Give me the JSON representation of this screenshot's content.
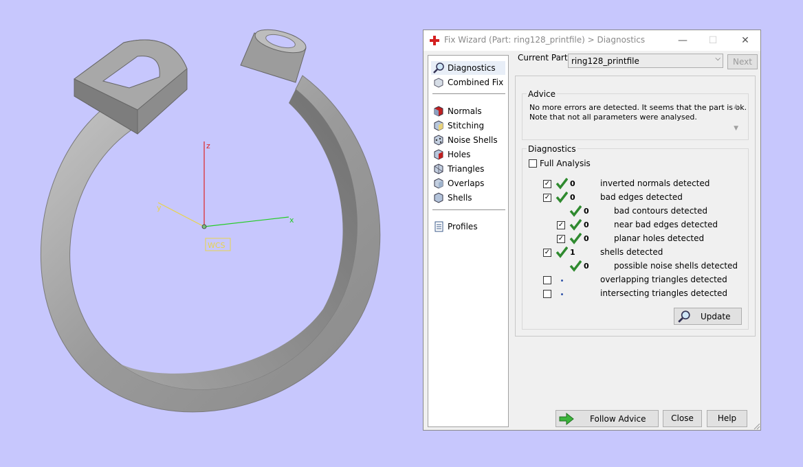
{
  "viewport": {
    "axis_z": "z",
    "axis_y": "y",
    "axis_x": "x",
    "wcs_label": "WCS"
  },
  "window": {
    "title": "Fix Wizard (Part: ring128_printfile) > Diagnostics",
    "minimize_glyph": "—",
    "maximize_glyph": "☐",
    "close_glyph": "✕"
  },
  "nav": {
    "diagnostics": "Diagnostics",
    "combined_fix": "Combined Fix",
    "normals": "Normals",
    "stitching": "Stitching",
    "noise_shells": "Noise Shells",
    "holes": "Holes",
    "triangles": "Triangles",
    "overlaps": "Overlaps",
    "shells": "Shells",
    "profiles": "Profiles"
  },
  "current_part": {
    "label": "Current Part:",
    "value": "ring128_printfile",
    "next_button": "Next"
  },
  "advice": {
    "title": "Advice",
    "line1": "No more errors are detected. It seems that the part is ok.",
    "line2": "Note that not all parameters were analysed."
  },
  "diagnostics": {
    "title": "Diagnostics",
    "full_analysis": "Full Analysis",
    "rows": [
      {
        "count": "0",
        "text": "inverted normals detected"
      },
      {
        "count": "0",
        "text": "bad edges detected"
      },
      {
        "count": "0",
        "text": "bad contours detected"
      },
      {
        "count": "0",
        "text": "near bad edges detected"
      },
      {
        "count": "0",
        "text": "planar holes detected"
      },
      {
        "count": "1",
        "text": "shells detected"
      },
      {
        "count": "0",
        "text": "possible noise shells detected"
      },
      {
        "count": "",
        "text": "overlapping triangles detected"
      },
      {
        "count": "",
        "text": "intersecting triangles detected"
      }
    ],
    "update_button": "Update"
  },
  "footer": {
    "follow_advice": "Follow Advice",
    "close": "Close",
    "help": "Help"
  },
  "colors": {
    "background": "#c7c7fd",
    "check_green": "#2f8a2f",
    "axis_z": "#dd2222",
    "axis_x": "#22cc22",
    "axis_y": "#e8d44a"
  }
}
